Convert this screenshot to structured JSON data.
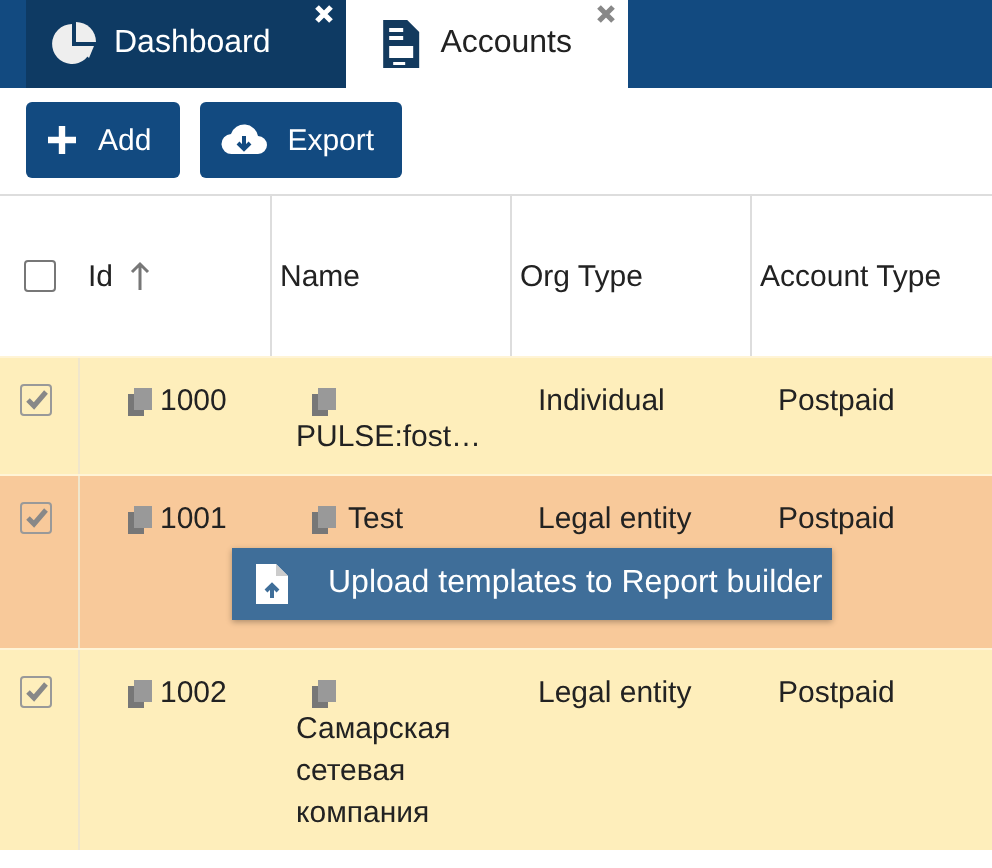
{
  "tabs": [
    {
      "label": "Dashboard",
      "selected": false,
      "kind": "pie"
    },
    {
      "label": "Accounts",
      "selected": true,
      "kind": "doc"
    }
  ],
  "toolbar": [
    {
      "label": "Add",
      "kind": "plus"
    },
    {
      "label": "Export",
      "kind": "cloud"
    }
  ],
  "table": {
    "select_all": {
      "checked": false
    },
    "columns": [
      {
        "label": "Id",
        "sorted": true
      },
      {
        "label": "Name"
      },
      {
        "label": "Org Type"
      },
      {
        "label": "Account Type"
      }
    ],
    "rows": [
      {
        "checked": true,
        "selected": false,
        "id": "1000",
        "name": "PULSE:fost…",
        "org_type": "Individual",
        "account_type": "Postpaid"
      },
      {
        "checked": true,
        "selected": true,
        "id": "1001",
        "name": "Test",
        "org_type": "Legal entity",
        "account_type": "Postpaid"
      },
      {
        "checked": true,
        "selected": false,
        "id": "1002",
        "name": "Самарская сетевая компания",
        "org_type": "Legal entity",
        "account_type": "Postpaid"
      }
    ]
  },
  "tooltip": {
    "label": "Upload templates to Report builder"
  }
}
